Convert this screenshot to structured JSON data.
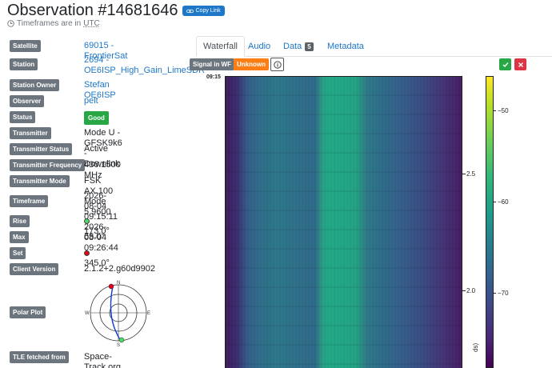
{
  "header": {
    "title": "Observation #14681646",
    "copy_label": "Copy Link",
    "timeframe_prefix": "Timeframes are in",
    "timeframe_zone": "UTC"
  },
  "details": {
    "satellite": {
      "label": "Satellite",
      "value": "69015 - FrontierSat"
    },
    "station": {
      "label": "Station",
      "line1": "2694 -",
      "line2": "OE6ISP_High_Gain_LimeSDR"
    },
    "station_owner": {
      "label": "Station Owner",
      "value": "Stefan OE6ISP"
    },
    "observer": {
      "label": "Observer",
      "value": "pelt"
    },
    "status": {
      "label": "Status",
      "value": "Good"
    },
    "transmitter": {
      "label": "Transmitter",
      "value": "Mode U - GFSK9k6 - Downlink"
    },
    "transmitter_status": {
      "label": "Transmitter Status",
      "value": "Active"
    },
    "transmitter_frequency": {
      "label": "Transmitter Frequency",
      "value": "436.1500 MHz"
    },
    "transmitter_mode": {
      "label": "Transmitter Mode",
      "value": "FSK AX.100 Mode 5 9600"
    },
    "timeframe": {
      "label": "Timeframe",
      "start_date": "2026-08-04",
      "start_time": "09:15:11",
      "end_date": "2026-08-04",
      "end_time": "09:26:44"
    },
    "rise": {
      "label": "Rise",
      "value": "173.0°"
    },
    "max": {
      "label": "Max",
      "value": "65.0°"
    },
    "set": {
      "label": "Set",
      "value": "345.0°"
    },
    "client_version": {
      "label": "Client Version",
      "value": "2.1.2+2.g60d9902"
    },
    "polar_plot": {
      "label": "Polar Plot",
      "n": "N",
      "e": "E",
      "s": "S",
      "w": "W"
    },
    "tle": {
      "label": "TLE fetched from",
      "value": "Space-Track.org"
    }
  },
  "tabs": [
    {
      "label": "Waterfall",
      "active": true
    },
    {
      "label": "Audio"
    },
    {
      "label": "Data",
      "badge": "5"
    },
    {
      "label": "Metadata"
    }
  ],
  "waterfall_toolbar": {
    "signal_label": "Signal in WF",
    "unknown_label": "Unknown",
    "info_icon": "info-icon",
    "approve_icon": "check-icon",
    "reject_icon": "close-icon"
  },
  "waterfall": {
    "time_label": "09:15",
    "y_ticks": [
      "2.5",
      "2.0"
    ],
    "y_axis_title_fragment": "ds)",
    "colorbar_ticks": [
      "−50",
      "−60",
      "−70"
    ]
  },
  "colors": {
    "accent": "#1e77c8",
    "label_bg": "#6c757d",
    "good": "#28a745",
    "unknown": "#fd7e14",
    "approve": "#28a745",
    "reject": "#dc3545"
  }
}
